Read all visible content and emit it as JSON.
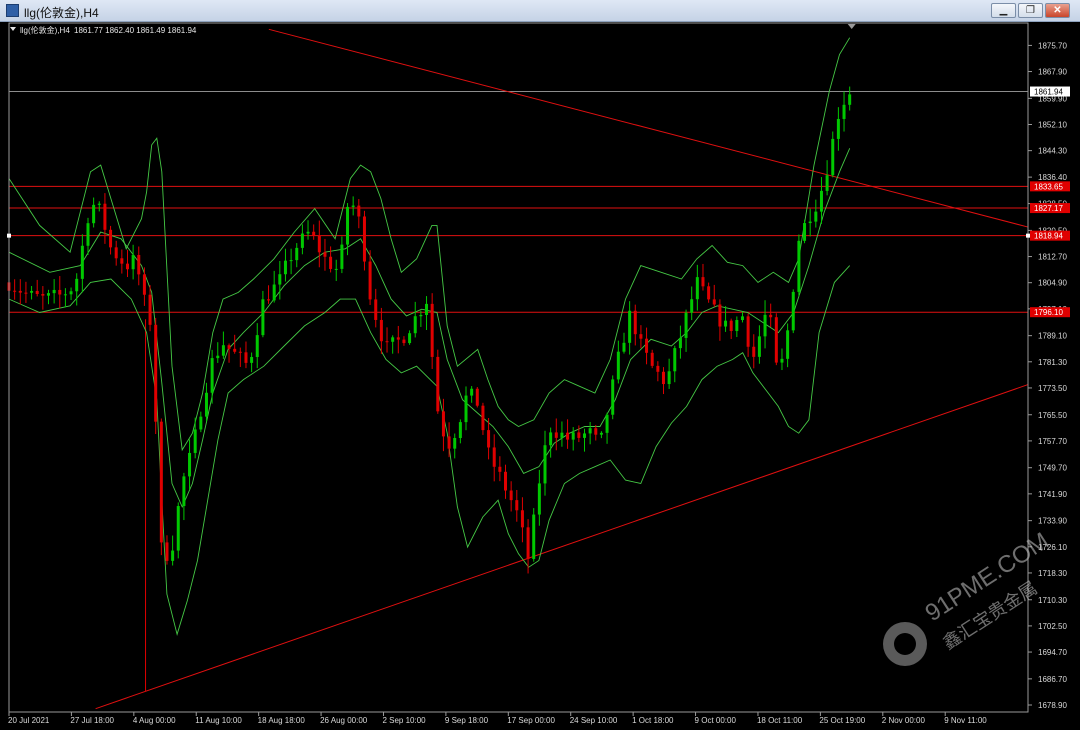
{
  "window": {
    "title": "llg(伦敦金),H4",
    "minimize_glyph": "▁",
    "maximize_glyph": "❐",
    "close_glyph": "✕"
  },
  "header": {
    "symbol": "llg(伦敦金),H4",
    "ohlc": "1861.77 1862.40 1861.49 1861.94"
  },
  "watermark": {
    "brand": "91PME.COM",
    "tagline": "鑫汇宝贵金属"
  },
  "colors": {
    "background": "#000000",
    "bull": "#00c800",
    "bear": "#e00000",
    "bands": "#45c845",
    "lines": "#e01010",
    "price_tag": "#e00000"
  },
  "chart_data": {
    "type": "candlestick",
    "ylim": [
      1678.9,
      1879.7
    ],
    "y_ticks": [
      "1875.70",
      "1867.90",
      "1859.90",
      "1852.10",
      "1844.30",
      "1836.40",
      "1828.50",
      "1820.50",
      "1812.70",
      "1804.90",
      "1797.10",
      "1789.10",
      "1781.30",
      "1773.50",
      "1765.50",
      "1757.70",
      "1749.70",
      "1741.90",
      "1733.90",
      "1726.10",
      "1718.30",
      "1710.30",
      "1702.50",
      "1694.70",
      "1686.70",
      "1678.90"
    ],
    "x_ticks": [
      "20 Jul 2021",
      "27 Jul 18:00",
      "4 Aug 00:00",
      "11 Aug 10:00",
      "18 Aug 18:00",
      "26 Aug 00:00",
      "2 Sep 10:00",
      "9 Sep 18:00",
      "17 Sep 00:00",
      "24 Sep 10:00",
      "1 Oct 18:00",
      "9 Oct 00:00",
      "18 Oct 11:00",
      "25 Oct 19:00",
      "2 Nov 00:00",
      "9 Nov 11:00"
    ],
    "current_price": "1861.94",
    "current_price_value": 1861.94,
    "horizontal_levels": [
      {
        "label": "1833.65",
        "value": 1833.65
      },
      {
        "label": "1827.17",
        "value": 1827.17
      },
      {
        "label": "1818.94",
        "value": 1818.94
      },
      {
        "label": "1796.10",
        "value": 1796.1
      }
    ],
    "trendlines": [
      {
        "x1": 0.255,
        "y1": 1880.5,
        "x2": 1.0,
        "y2": 1821.5
      },
      {
        "x1": 0.085,
        "y1": 1677.8,
        "x2": 1.0,
        "y2": 1774.5
      }
    ],
    "price_path": [
      [
        0.0,
        1805
      ],
      [
        0.02,
        1801
      ],
      [
        0.035,
        1800
      ],
      [
        0.05,
        1801
      ],
      [
        0.065,
        1804
      ],
      [
        0.08,
        1829
      ],
      [
        0.09,
        1826
      ],
      [
        0.1,
        1815
      ],
      [
        0.115,
        1810
      ],
      [
        0.125,
        1812
      ],
      [
        0.13,
        1802
      ],
      [
        0.14,
        1792
      ],
      [
        0.15,
        1722
      ],
      [
        0.16,
        1726
      ],
      [
        0.17,
        1745
      ],
      [
        0.18,
        1755
      ],
      [
        0.19,
        1770
      ],
      [
        0.2,
        1782
      ],
      [
        0.21,
        1787
      ],
      [
        0.22,
        1784
      ],
      [
        0.235,
        1780
      ],
      [
        0.25,
        1800
      ],
      [
        0.265,
        1805
      ],
      [
        0.28,
        1815
      ],
      [
        0.295,
        1820
      ],
      [
        0.31,
        1812
      ],
      [
        0.325,
        1808
      ],
      [
        0.33,
        1826
      ],
      [
        0.335,
        1830
      ],
      [
        0.345,
        1822
      ],
      [
        0.355,
        1800
      ],
      [
        0.37,
        1785
      ],
      [
        0.385,
        1788
      ],
      [
        0.4,
        1795
      ],
      [
        0.41,
        1800
      ],
      [
        0.42,
        1768
      ],
      [
        0.43,
        1756
      ],
      [
        0.44,
        1762
      ],
      [
        0.45,
        1772
      ],
      [
        0.46,
        1769
      ],
      [
        0.47,
        1754
      ],
      [
        0.48,
        1748
      ],
      [
        0.49,
        1742
      ],
      [
        0.5,
        1735
      ],
      [
        0.51,
        1722
      ],
      [
        0.52,
        1745
      ],
      [
        0.53,
        1762
      ],
      [
        0.55,
        1758
      ],
      [
        0.57,
        1760
      ],
      [
        0.58,
        1756
      ],
      [
        0.6,
        1785
      ],
      [
        0.61,
        1796
      ],
      [
        0.62,
        1786
      ],
      [
        0.63,
        1780
      ],
      [
        0.645,
        1775
      ],
      [
        0.66,
        1790
      ],
      [
        0.675,
        1805
      ],
      [
        0.69,
        1797
      ],
      [
        0.705,
        1791
      ],
      [
        0.72,
        1795
      ],
      [
        0.73,
        1782
      ],
      [
        0.745,
        1798
      ],
      [
        0.755,
        1775
      ],
      [
        0.765,
        1792
      ],
      [
        0.775,
        1818
      ],
      [
        0.785,
        1825
      ],
      [
        0.795,
        1830
      ],
      [
        0.805,
        1842
      ],
      [
        0.815,
        1857
      ],
      [
        0.825,
        1862
      ]
    ],
    "candle_count": 150,
    "bollinger_bands": {
      "upper": [
        [
          0.0,
          1836
        ],
        [
          0.03,
          1822
        ],
        [
          0.06,
          1814
        ],
        [
          0.08,
          1838
        ],
        [
          0.09,
          1840
        ],
        [
          0.1,
          1830
        ],
        [
          0.115,
          1815
        ],
        [
          0.13,
          1824
        ],
        [
          0.135,
          1832
        ],
        [
          0.14,
          1846
        ],
        [
          0.145,
          1848
        ],
        [
          0.15,
          1838
        ],
        [
          0.16,
          1780
        ],
        [
          0.17,
          1755
        ],
        [
          0.18,
          1760
        ],
        [
          0.19,
          1772
        ],
        [
          0.2,
          1790
        ],
        [
          0.21,
          1800
        ],
        [
          0.225,
          1802
        ],
        [
          0.24,
          1806
        ],
        [
          0.26,
          1812
        ],
        [
          0.28,
          1820
        ],
        [
          0.3,
          1827
        ],
        [
          0.32,
          1818
        ],
        [
          0.335,
          1836
        ],
        [
          0.345,
          1840
        ],
        [
          0.355,
          1838
        ],
        [
          0.365,
          1830
        ],
        [
          0.375,
          1818
        ],
        [
          0.385,
          1808
        ],
        [
          0.4,
          1812
        ],
        [
          0.415,
          1822
        ],
        [
          0.42,
          1822
        ],
        [
          0.43,
          1792
        ],
        [
          0.44,
          1780
        ],
        [
          0.46,
          1785
        ],
        [
          0.47,
          1776
        ],
        [
          0.48,
          1768
        ],
        [
          0.49,
          1764
        ],
        [
          0.5,
          1762
        ],
        [
          0.515,
          1764
        ],
        [
          0.53,
          1772
        ],
        [
          0.545,
          1776
        ],
        [
          0.56,
          1774
        ],
        [
          0.575,
          1772
        ],
        [
          0.59,
          1782
        ],
        [
          0.605,
          1800
        ],
        [
          0.62,
          1810
        ],
        [
          0.64,
          1808
        ],
        [
          0.66,
          1806
        ],
        [
          0.675,
          1812
        ],
        [
          0.69,
          1816
        ],
        [
          0.705,
          1811
        ],
        [
          0.72,
          1810
        ],
        [
          0.735,
          1805
        ],
        [
          0.75,
          1808
        ],
        [
          0.765,
          1805
        ],
        [
          0.775,
          1812
        ],
        [
          0.79,
          1840
        ],
        [
          0.805,
          1862
        ],
        [
          0.815,
          1873
        ],
        [
          0.825,
          1878
        ]
      ],
      "middle": [
        [
          0.0,
          1814
        ],
        [
          0.04,
          1808
        ],
        [
          0.07,
          1810
        ],
        [
          0.09,
          1820
        ],
        [
          0.11,
          1818
        ],
        [
          0.13,
          1810
        ],
        [
          0.14,
          1802
        ],
        [
          0.15,
          1775
        ],
        [
          0.16,
          1745
        ],
        [
          0.17,
          1738
        ],
        [
          0.18,
          1745
        ],
        [
          0.19,
          1758
        ],
        [
          0.2,
          1772
        ],
        [
          0.215,
          1785
        ],
        [
          0.23,
          1790
        ],
        [
          0.25,
          1796
        ],
        [
          0.27,
          1804
        ],
        [
          0.29,
          1810
        ],
        [
          0.31,
          1814
        ],
        [
          0.33,
          1815
        ],
        [
          0.345,
          1818
        ],
        [
          0.36,
          1810
        ],
        [
          0.375,
          1800
        ],
        [
          0.39,
          1795
        ],
        [
          0.405,
          1797
        ],
        [
          0.42,
          1796
        ],
        [
          0.43,
          1782
        ],
        [
          0.445,
          1770
        ],
        [
          0.46,
          1766
        ],
        [
          0.475,
          1762
        ],
        [
          0.49,
          1756
        ],
        [
          0.505,
          1748
        ],
        [
          0.52,
          1750
        ],
        [
          0.535,
          1757
        ],
        [
          0.55,
          1760
        ],
        [
          0.565,
          1762
        ],
        [
          0.58,
          1762
        ],
        [
          0.595,
          1770
        ],
        [
          0.61,
          1782
        ],
        [
          0.63,
          1788
        ],
        [
          0.65,
          1786
        ],
        [
          0.665,
          1790
        ],
        [
          0.68,
          1796
        ],
        [
          0.695,
          1798
        ],
        [
          0.71,
          1797
        ],
        [
          0.725,
          1796
        ],
        [
          0.74,
          1793
        ],
        [
          0.755,
          1790
        ],
        [
          0.77,
          1796
        ],
        [
          0.785,
          1810
        ],
        [
          0.8,
          1826
        ],
        [
          0.815,
          1838
        ],
        [
          0.825,
          1845
        ]
      ],
      "lower": [
        [
          0.0,
          1800
        ],
        [
          0.03,
          1796
        ],
        [
          0.06,
          1798
        ],
        [
          0.08,
          1805
        ],
        [
          0.1,
          1806
        ],
        [
          0.12,
          1800
        ],
        [
          0.135,
          1790
        ],
        [
          0.145,
          1770
        ],
        [
          0.15,
          1740
        ],
        [
          0.155,
          1712
        ],
        [
          0.165,
          1700
        ],
        [
          0.175,
          1710
        ],
        [
          0.185,
          1722
        ],
        [
          0.195,
          1740
        ],
        [
          0.205,
          1758
        ],
        [
          0.215,
          1772
        ],
        [
          0.23,
          1776
        ],
        [
          0.25,
          1780
        ],
        [
          0.27,
          1786
        ],
        [
          0.29,
          1792
        ],
        [
          0.31,
          1796
        ],
        [
          0.325,
          1800
        ],
        [
          0.34,
          1800
        ],
        [
          0.355,
          1790
        ],
        [
          0.37,
          1782
        ],
        [
          0.385,
          1778
        ],
        [
          0.4,
          1780
        ],
        [
          0.42,
          1774
        ],
        [
          0.43,
          1760
        ],
        [
          0.44,
          1738
        ],
        [
          0.45,
          1726
        ],
        [
          0.465,
          1735
        ],
        [
          0.48,
          1740
        ],
        [
          0.49,
          1730
        ],
        [
          0.5,
          1724
        ],
        [
          0.51,
          1720
        ],
        [
          0.52,
          1722
        ],
        [
          0.53,
          1734
        ],
        [
          0.545,
          1745
        ],
        [
          0.56,
          1748
        ],
        [
          0.575,
          1750
        ],
        [
          0.59,
          1752
        ],
        [
          0.605,
          1746
        ],
        [
          0.62,
          1745
        ],
        [
          0.635,
          1756
        ],
        [
          0.65,
          1763
        ],
        [
          0.665,
          1768
        ],
        [
          0.68,
          1776
        ],
        [
          0.695,
          1780
        ],
        [
          0.71,
          1782
        ],
        [
          0.72,
          1784
        ],
        [
          0.73,
          1778
        ],
        [
          0.745,
          1772
        ],
        [
          0.755,
          1768
        ],
        [
          0.765,
          1762
        ],
        [
          0.775,
          1760
        ],
        [
          0.785,
          1764
        ],
        [
          0.795,
          1790
        ],
        [
          0.81,
          1805
        ],
        [
          0.825,
          1810
        ]
      ]
    }
  }
}
